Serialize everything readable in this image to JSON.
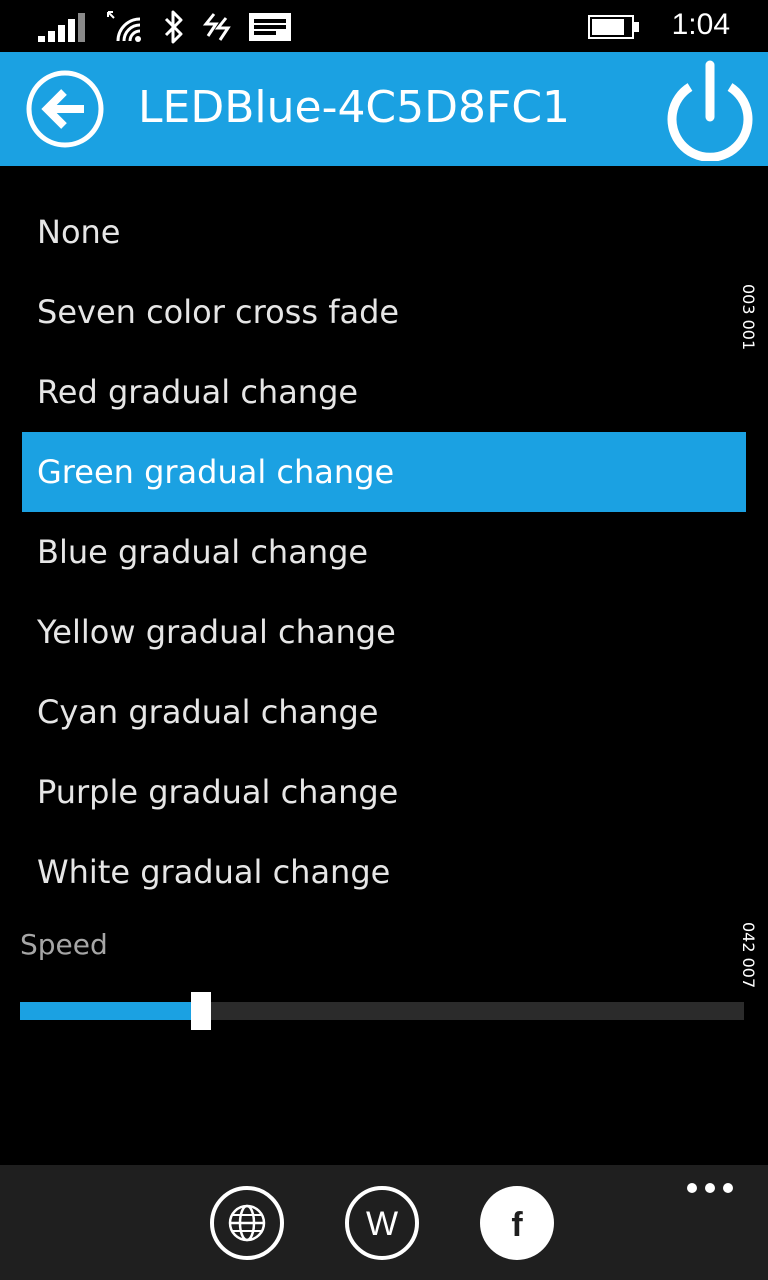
{
  "status_bar": {
    "time": "1:04",
    "icons": [
      "signal-strength-icon",
      "wifi-icon",
      "bluetooth-icon",
      "data-sense-icon",
      "message-icon",
      "battery-icon"
    ]
  },
  "header": {
    "title": "LEDBlue-4C5D8FC1",
    "back_icon": "back-arrow-icon",
    "power_icon": "power-icon",
    "background_color": "#1ba1e2"
  },
  "effects": {
    "items": [
      {
        "label": "None"
      },
      {
        "label": "Seven color cross fade"
      },
      {
        "label": "Red gradual change"
      },
      {
        "label": "Green gradual change"
      },
      {
        "label": "Blue gradual change"
      },
      {
        "label": "Yellow gradual change"
      },
      {
        "label": "Cyan gradual change"
      },
      {
        "label": "Purple gradual change"
      },
      {
        "label": "White gradual change"
      }
    ],
    "selected_index": 3,
    "selected_color": "#1ba1e2"
  },
  "side_readouts": {
    "top": "003  001",
    "bottom": "042  007"
  },
  "speed": {
    "label": "Speed",
    "fraction": 0.25,
    "fill_color": "#1ba1e2"
  },
  "app_bar": {
    "buttons": [
      {
        "icon": "globe-icon"
      },
      {
        "icon": "w-icon",
        "glyph": "W"
      },
      {
        "icon": "facebook-icon",
        "glyph": "f"
      }
    ],
    "more_icon": "more-dots-icon"
  }
}
